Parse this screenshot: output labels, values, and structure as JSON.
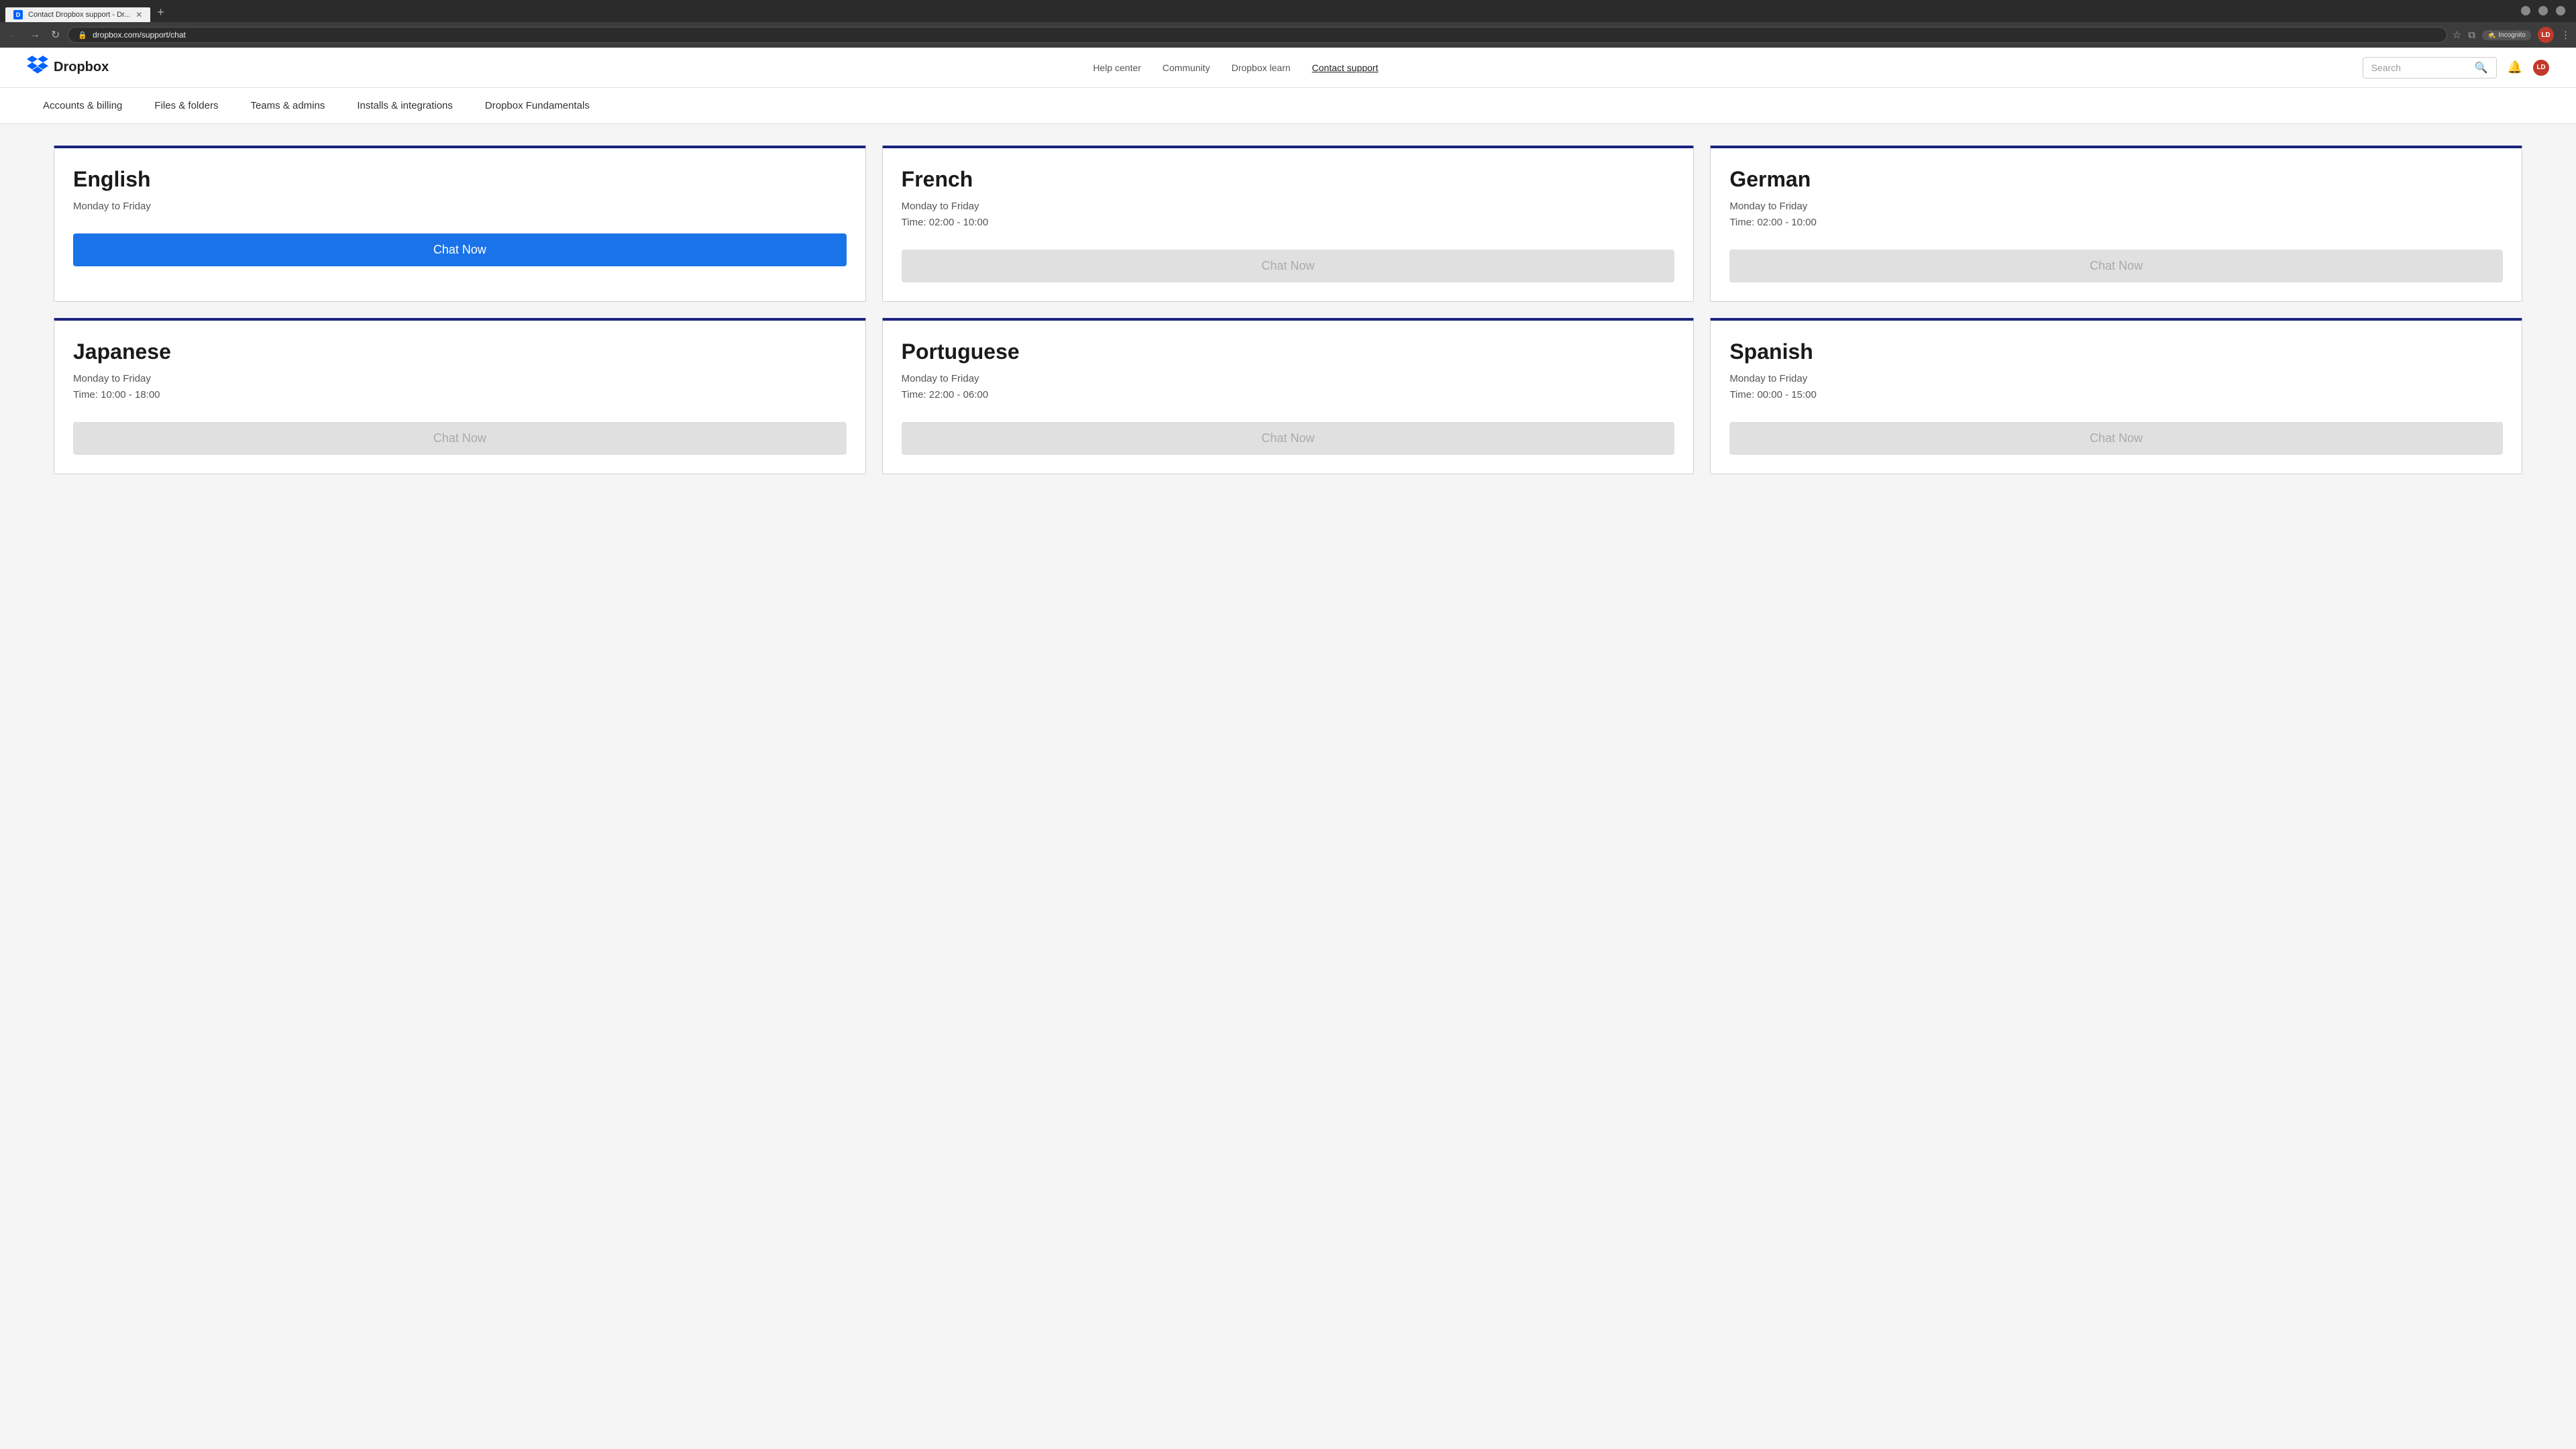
{
  "browser": {
    "tab_active_title": "Contact Dropbox support - Dr...",
    "tab_active_favicon": "D",
    "url": "dropbox.com/support/chat",
    "incognito_label": "Incognito",
    "user_initials": "LD"
  },
  "header": {
    "logo_text": "Dropbox",
    "nav": {
      "help_center": "Help center",
      "community": "Community",
      "dropbox_learn": "Dropbox learn",
      "contact_support": "Contact support"
    },
    "search_placeholder": "Search"
  },
  "category_nav": {
    "items": [
      "Accounts & billing",
      "Files & folders",
      "Teams & admins",
      "Installs & integrations",
      "Dropbox Fundamentals"
    ]
  },
  "cards": [
    {
      "language": "English",
      "schedule_line1": "Monday to Friday",
      "schedule_line2": "",
      "button_label": "Chat Now",
      "button_active": true
    },
    {
      "language": "French",
      "schedule_line1": "Monday to Friday",
      "schedule_line2": "Time: 02:00 - 10:00",
      "button_label": "Chat Now",
      "button_active": false
    },
    {
      "language": "German",
      "schedule_line1": "Monday to Friday",
      "schedule_line2": "Time: 02:00 - 10:00",
      "button_label": "Chat Now",
      "button_active": false
    },
    {
      "language": "Japanese",
      "schedule_line1": "Monday to Friday",
      "schedule_line2": "Time: 10:00 - 18:00",
      "button_label": "Chat Now",
      "button_active": false
    },
    {
      "language": "Portuguese",
      "schedule_line1": "Monday to Friday",
      "schedule_line2": "Time: 22:00 - 06:00",
      "button_label": "Chat Now",
      "button_active": false
    },
    {
      "language": "Spanish",
      "schedule_line1": "Monday to Friday",
      "schedule_line2": "Time: 00:00 - 15:00",
      "button_label": "Chat Now",
      "button_active": false
    }
  ]
}
